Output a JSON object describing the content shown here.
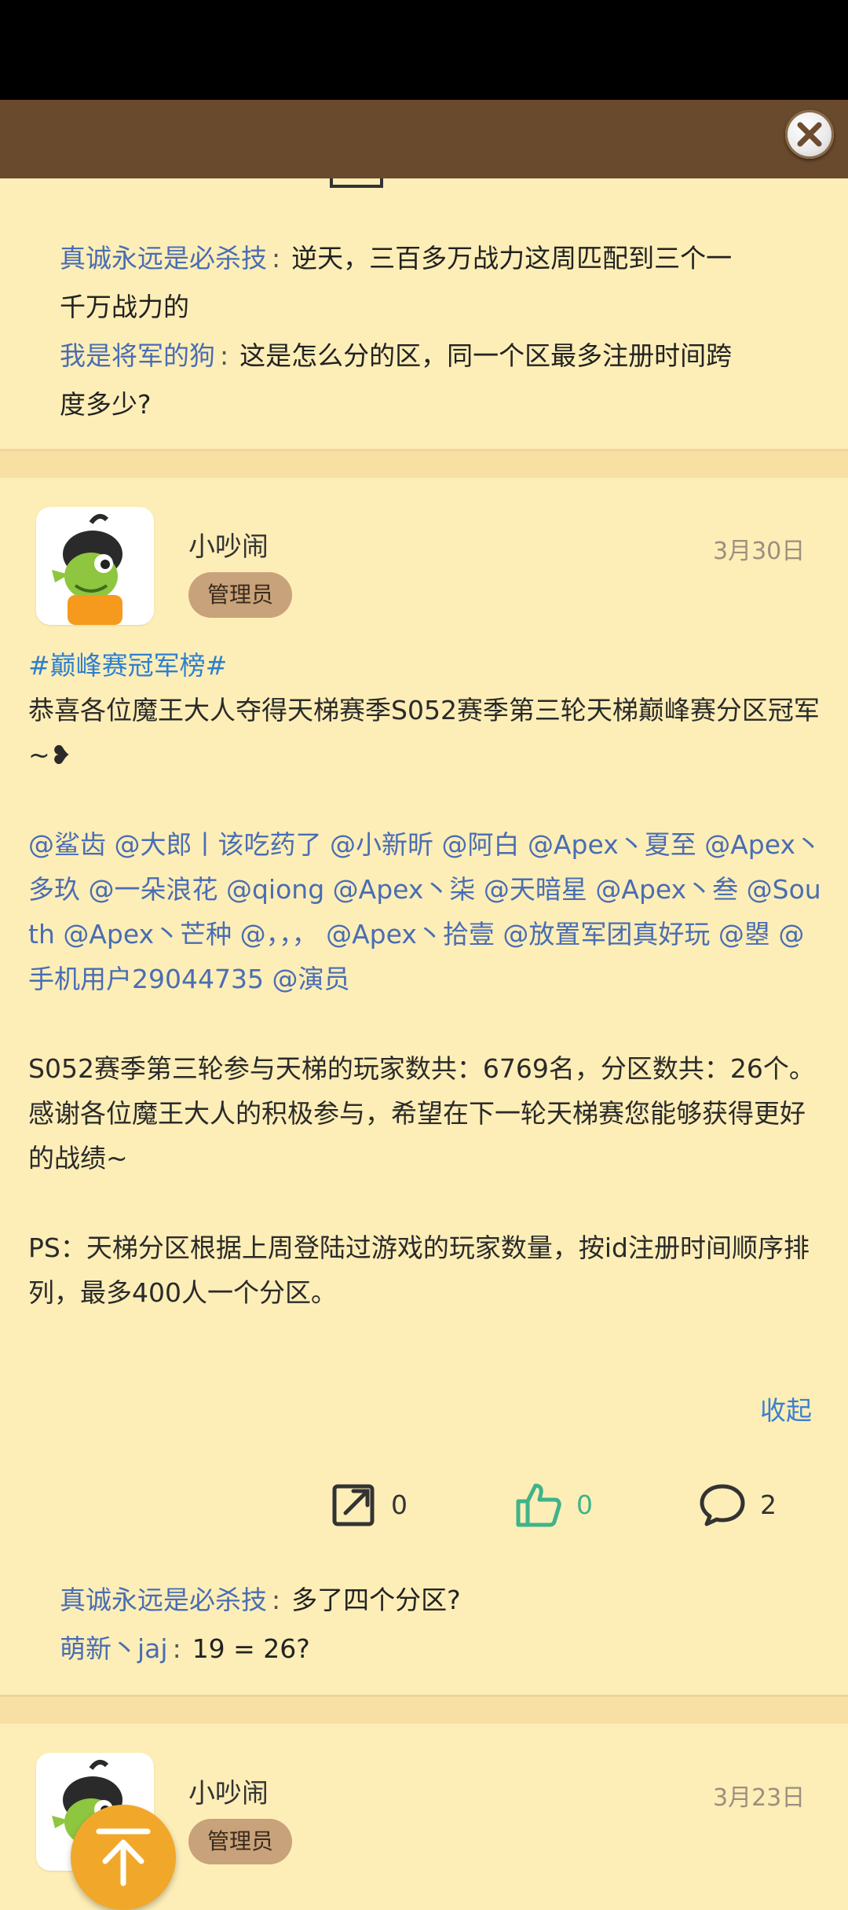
{
  "top_comments": [
    {
      "user": "真诚永远是必杀技",
      "text": "逆天，三百多万战力这周匹配到三个一",
      "text_cont": "千万战力的"
    },
    {
      "user": "我是将军的狗",
      "text": "这是怎么分的区，同一个区最多注册时间跨",
      "text_cont": "度多少?"
    }
  ],
  "post1": {
    "author": "小吵闹",
    "role": "管理员",
    "date": "3月30日",
    "hashtag": "#巅峰赛冠军榜#",
    "line1": "恭喜各位魔王大人夺得天梯赛季S052赛季第三轮天梯巅峰赛分区冠军~❥",
    "mentions": "@鲨齿 @大郎丨该吃药了 @小新昕 @阿白 @Apex丶夏至 @Apex丶多玖 @一朵浪花 @qiong @Apex丶柒 @天暗星 @Apex丶叁 @South @Apex丶芒种 @，，， @Apex丶拾壹 @放置军团真好玩 @曌 @手机用户29044735 @演员",
    "stats": "S052赛季第三轮参与天梯的玩家数共：6769名，分区数共：26个。",
    "thanks": "感谢各位魔王大人的积极参与，希望在下一轮天梯赛您能够获得更好的战绩~",
    "ps": "PS：天梯分区根据上周登陆过游戏的玩家数量，按id注册时间顺序排列，最多400人一个分区。",
    "collapse": "收起",
    "share_count": "0",
    "like_count": "0",
    "comment_count": "2",
    "comments": [
      {
        "user": "真诚永远是必杀技",
        "text": "多了四个分区?"
      },
      {
        "user": "萌新丶jaj",
        "text": "19 = 26?"
      }
    ]
  },
  "post2": {
    "author": "小吵闹",
    "role": "管理员",
    "date": "3月23日"
  },
  "icons": {
    "close": "close-icon",
    "share": "share-icon",
    "like": "thumbs-up-icon",
    "comment": "comment-icon",
    "scroll_top": "arrow-up-icon"
  },
  "colors": {
    "background": "#fdeeb7",
    "top_bar": "#694a2d",
    "link": "#4a6db3",
    "like": "#3fb38a",
    "scroll_button": "#f1a82a"
  }
}
